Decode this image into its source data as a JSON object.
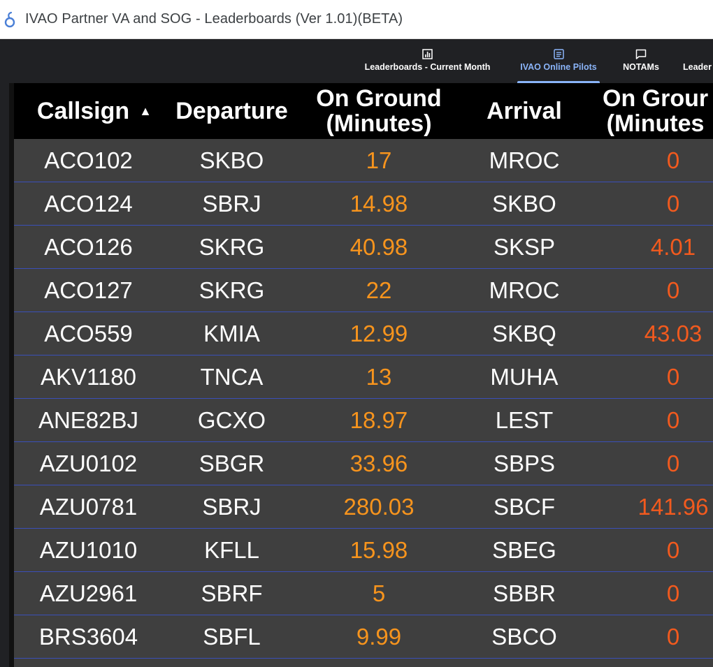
{
  "window": {
    "title": "IVAO Partner VA and SOG - Leaderboards (Ver 1.01)(BETA)"
  },
  "nav": {
    "tabs": [
      {
        "label": "Leaderboards - Current Month",
        "icon": "leaderboard-chart-icon",
        "active": false
      },
      {
        "label": "IVAO Online Pilots",
        "icon": "document-icon",
        "active": true
      },
      {
        "label": "NOTAMs",
        "icon": "chat-bubble-icon",
        "active": false
      },
      {
        "label": "Leader",
        "icon": "",
        "active": false
      }
    ]
  },
  "table": {
    "headers": [
      "Callsign",
      "Departure",
      "On Ground\n(Minutes)",
      "Arrival",
      "On Grour\n(Minutes"
    ],
    "sort_indicator": "▲",
    "rows": [
      {
        "callsign": "ACO102",
        "departure": "SKBO",
        "dep_ground": "17",
        "arrival": "MROC",
        "arr_ground": "0"
      },
      {
        "callsign": "ACO124",
        "departure": "SBRJ",
        "dep_ground": "14.98",
        "arrival": "SKBO",
        "arr_ground": "0"
      },
      {
        "callsign": "ACO126",
        "departure": "SKRG",
        "dep_ground": "40.98",
        "arrival": "SKSP",
        "arr_ground": "4.01"
      },
      {
        "callsign": "ACO127",
        "departure": "SKRG",
        "dep_ground": "22",
        "arrival": "MROC",
        "arr_ground": "0"
      },
      {
        "callsign": "ACO559",
        "departure": "KMIA",
        "dep_ground": "12.99",
        "arrival": "SKBQ",
        "arr_ground": "43.03"
      },
      {
        "callsign": "AKV1180",
        "departure": "TNCA",
        "dep_ground": "13",
        "arrival": "MUHA",
        "arr_ground": "0"
      },
      {
        "callsign": "ANE82BJ",
        "departure": "GCXO",
        "dep_ground": "18.97",
        "arrival": "LEST",
        "arr_ground": "0"
      },
      {
        "callsign": "AZU0102",
        "departure": "SBGR",
        "dep_ground": "33.96",
        "arrival": "SBPS",
        "arr_ground": "0"
      },
      {
        "callsign": "AZU0781",
        "departure": "SBRJ",
        "dep_ground": "280.03",
        "arrival": "SBCF",
        "arr_ground": "141.96"
      },
      {
        "callsign": "AZU1010",
        "departure": "KFLL",
        "dep_ground": "15.98",
        "arrival": "SBEG",
        "arr_ground": "0"
      },
      {
        "callsign": "AZU2961",
        "departure": "SBRF",
        "dep_ground": "5",
        "arrival": "SBBR",
        "arr_ground": "0"
      },
      {
        "callsign": "BRS3604",
        "departure": "SBFL",
        "dep_ground": "9.99",
        "arrival": "SBCO",
        "arr_ground": "0"
      }
    ]
  },
  "colors": {
    "nav_background": "#202124",
    "active_tab": "#8ab4f8",
    "header_background": "#000000",
    "row_background": "#3f3f3f",
    "row_divider": "#3a4fb8",
    "departure_ground_text": "#f7941d",
    "arrival_ground_text": "#f25a1e"
  }
}
